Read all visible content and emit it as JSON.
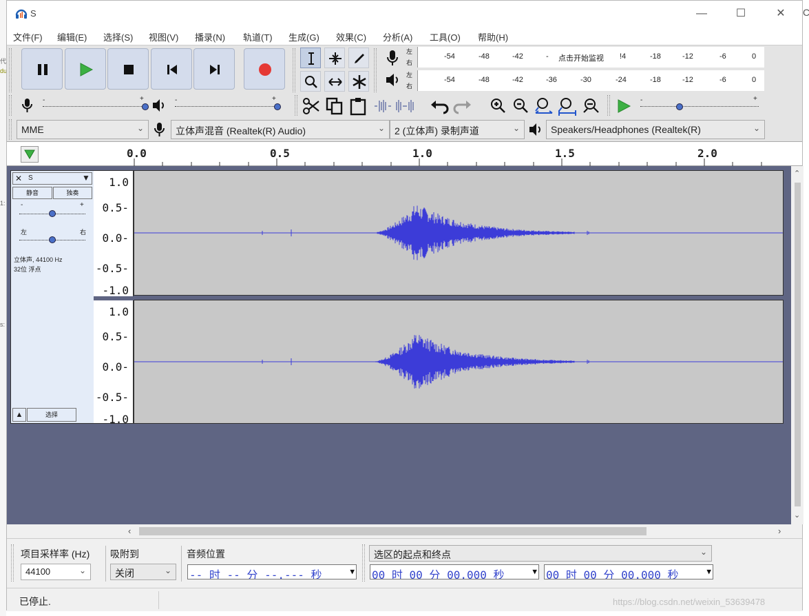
{
  "window": {
    "title": "S"
  },
  "menu": [
    "文件(F)",
    "编辑(E)",
    "选择(S)",
    "视图(V)",
    "播录(N)",
    "轨道(T)",
    "生成(G)",
    "效果(C)",
    "分析(A)",
    "工具(O)",
    "帮助(H)"
  ],
  "meters": {
    "record_scale": [
      "-54",
      "-48",
      "-42",
      "-",
      "点击开始监视",
      "!4",
      "-18",
      "-12",
      "-6",
      "0"
    ],
    "play_scale": [
      "-54",
      "-48",
      "-42",
      "-36",
      "-30",
      "-24",
      "-18",
      "-12",
      "-6",
      "0"
    ],
    "channel_left": "左",
    "channel_right": "右"
  },
  "devices": {
    "host": "MME",
    "input": "立体声混音 (Realtek(R) Audio)",
    "channels": "2 (立体声) 录制声道",
    "output": "Speakers/Headphones (Realtek(R)"
  },
  "ruler": [
    "0.0",
    "0.5",
    "1.0",
    "1.5",
    "2.0"
  ],
  "track": {
    "name": "S",
    "mute": "静音",
    "solo": "独奏",
    "gain_minus": "-",
    "gain_plus": "+",
    "pan_left": "左",
    "pan_right": "右",
    "info_line1": "立体声, 44100 Hz",
    "info_line2": "32位 浮点",
    "select": "选择",
    "scale": [
      "1.0",
      "0.5-",
      "0.0-",
      "-0.5-",
      "-1.0"
    ]
  },
  "selection_toolbar": {
    "rate_label": "项目采样率 (Hz)",
    "rate_value": "44100",
    "snap_label": "吸附到",
    "snap_value": "关闭",
    "position_label": "音频位置",
    "position_value": "-- 时 -- 分 --.--- 秒",
    "range_label": "选区的起点和终点",
    "start_value": "00 时 00 分 00.000 秒",
    "end_value": "00 时 00 分 00.000 秒"
  },
  "status": {
    "text": "已停止.",
    "watermark": "https://blog.csdn.net/weixin_53639478"
  },
  "colors": {
    "waveform": "#3c3cd8",
    "wave_bg": "#c8c8c8",
    "track_bg": "#5f6583",
    "record_red": "#e53935",
    "play_green": "#3cb043"
  }
}
